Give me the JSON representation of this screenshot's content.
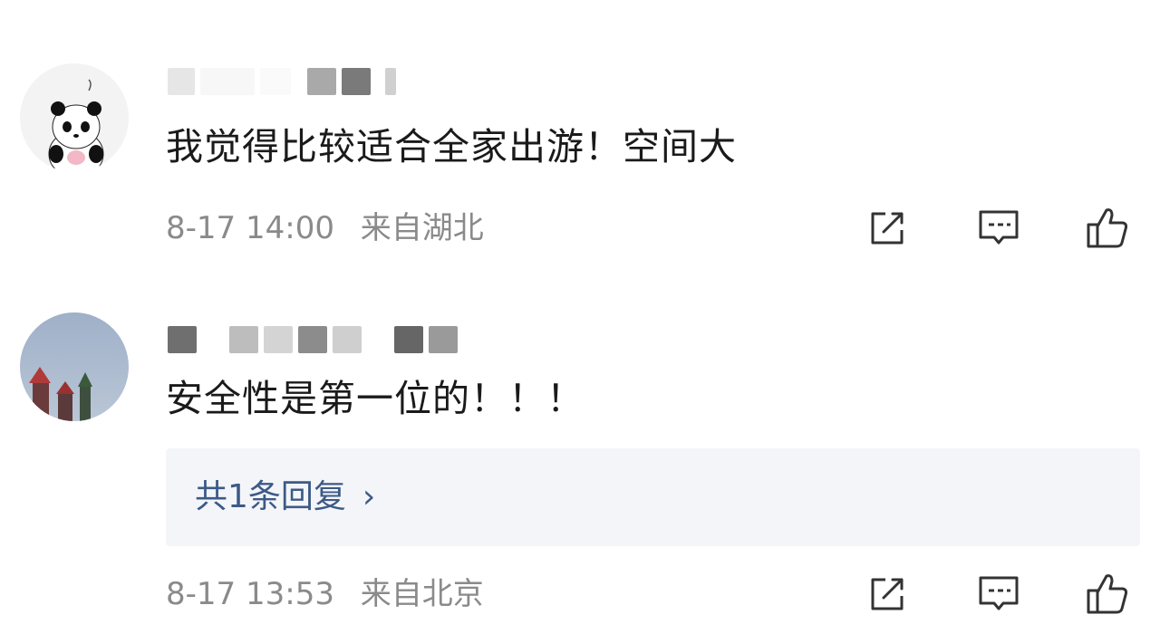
{
  "comments": [
    {
      "text": "我觉得比较适合全家出游！空间大",
      "time": "8-17 14:00",
      "location": "来自湖北"
    },
    {
      "text": "安全性是第一位的！！！",
      "time": "8-17 13:53",
      "location": "来自北京",
      "reply": {
        "label": "共1条回复",
        "chevron": "›"
      }
    }
  ],
  "icons": {
    "share": "share-icon",
    "comment": "comment-icon",
    "like": "thumbs-up-icon"
  },
  "colors": {
    "text": "#1a1a1a",
    "meta": "#8a8a8a",
    "reply_link": "#3d5a86",
    "reply_bg": "#f4f5f9"
  }
}
